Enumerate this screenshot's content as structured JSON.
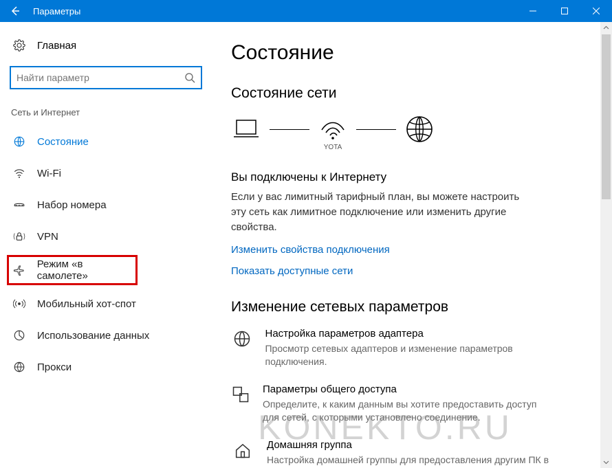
{
  "window": {
    "title": "Параметры"
  },
  "sidebar": {
    "home": "Главная",
    "search_placeholder": "Найти параметр",
    "group": "Сеть и Интернет",
    "items": [
      {
        "label": "Состояние"
      },
      {
        "label": "Wi-Fi"
      },
      {
        "label": "Набор номера"
      },
      {
        "label": "VPN"
      },
      {
        "label": "Режим «в самолете»"
      },
      {
        "label": "Мобильный хот-спот"
      },
      {
        "label": "Использование данных"
      },
      {
        "label": "Прокси"
      }
    ]
  },
  "main": {
    "title": "Состояние",
    "section_status": "Состояние сети",
    "diagram_wifi_caption": "YOTA",
    "connected_title": "Вы подключены к Интернету",
    "connected_desc": "Если у вас лимитный тарифный план, вы можете настроить эту сеть как лимитное подключение или изменить другие свойства.",
    "link_change_props": "Изменить свойства подключения",
    "link_show_networks": "Показать доступные сети",
    "section_change": "Изменение сетевых параметров",
    "options": [
      {
        "title": "Настройка параметров адаптера",
        "desc": "Просмотр сетевых адаптеров и изменение параметров подключения."
      },
      {
        "title": "Параметры общего доступа",
        "desc": "Определите, к каким данным вы хотите предоставить доступ для сетей, с которыми установлено соединение."
      },
      {
        "title": "Домашняя группа",
        "desc": "Настройка домашней группы для предоставления другим ПК в"
      }
    ]
  },
  "watermark": "KONEKTO.RU"
}
